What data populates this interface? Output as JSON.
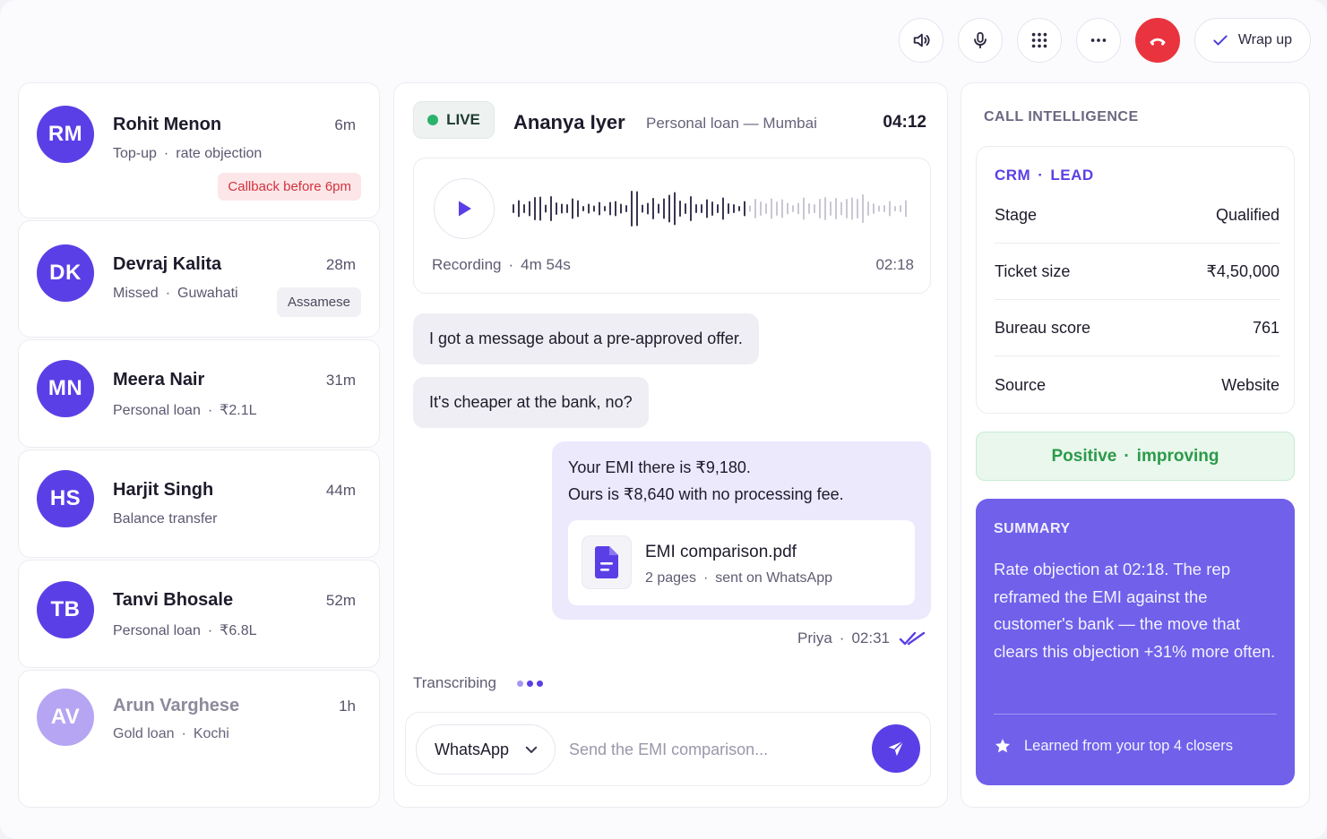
{
  "topbar": {
    "wrap_up_label": "Wrap up"
  },
  "contacts": [
    {
      "initials": "RM",
      "name": "Rohit Menon",
      "time": "6m",
      "sub1": "Top-up",
      "sub2": "rate objection",
      "tag": "Callback before 6pm"
    },
    {
      "initials": "DK",
      "name": "Devraj Kalita",
      "time": "28m",
      "sub1": "Missed",
      "sub2": "Guwahati",
      "tag": "Assamese"
    },
    {
      "initials": "MN",
      "name": "Meera Nair",
      "time": "31m",
      "sub1": "Personal loan",
      "sub2": "₹2.1L"
    },
    {
      "initials": "HS",
      "name": "Harjit Singh",
      "time": "44m",
      "sub1": "Balance transfer"
    },
    {
      "initials": "TB",
      "name": "Tanvi Bhosale",
      "time": "52m",
      "sub1": "Personal loan",
      "sub2": "₹6.8L"
    },
    {
      "initials": "AV",
      "name": "Arun Varghese",
      "time": "1h",
      "sub1": "Gold loan",
      "sub2": "Kochi"
    }
  ],
  "call": {
    "live_label": "LIVE",
    "name": "Ananya Iyer",
    "description": "Personal loan — Mumbai",
    "timer": "04:12",
    "recording_label": "Recording",
    "recording_length": "4m 54s",
    "recording_position": "02:18"
  },
  "messages": {
    "in1": "I got a message about a pre-approved offer.",
    "in2": "It's cheaper at the bank, no?",
    "out_line1": "Your EMI there is ₹9,180.",
    "out_line2": "Ours is ₹8,640 with no processing fee.",
    "attachment_name": "EMI comparison.pdf",
    "attachment_pages": "2 pages",
    "attachment_status": "sent on WhatsApp",
    "sender": "Priya",
    "sent_time": "02:31",
    "transcribing_label": "Transcribing"
  },
  "composer": {
    "channel": "WhatsApp",
    "placeholder": "Send the EMI comparison..."
  },
  "intel": {
    "title": "CALL INTELLIGENCE",
    "crm_label": "CRM",
    "crm_type": "LEAD",
    "rows": [
      {
        "label": "Stage",
        "value": "Qualified"
      },
      {
        "label": "Ticket size",
        "value": "₹4,50,000"
      },
      {
        "label": "Bureau score",
        "value": "761"
      },
      {
        "label": "Source",
        "value": "Website"
      }
    ],
    "sentiment": "Positive",
    "sentiment_trend": "improving",
    "summary_title": "SUMMARY",
    "summary_text": "Rate objection at 02:18. The rep reframed the EMI against the customer's bank — the move that clears this objection +31% more often.",
    "summary_footer": "Learned from your top 4 closers"
  },
  "colors": {
    "accent": "#5b3fe6",
    "hangup": "#e9343f",
    "live": "#2bb36b",
    "positive": "#2b9a4a"
  }
}
